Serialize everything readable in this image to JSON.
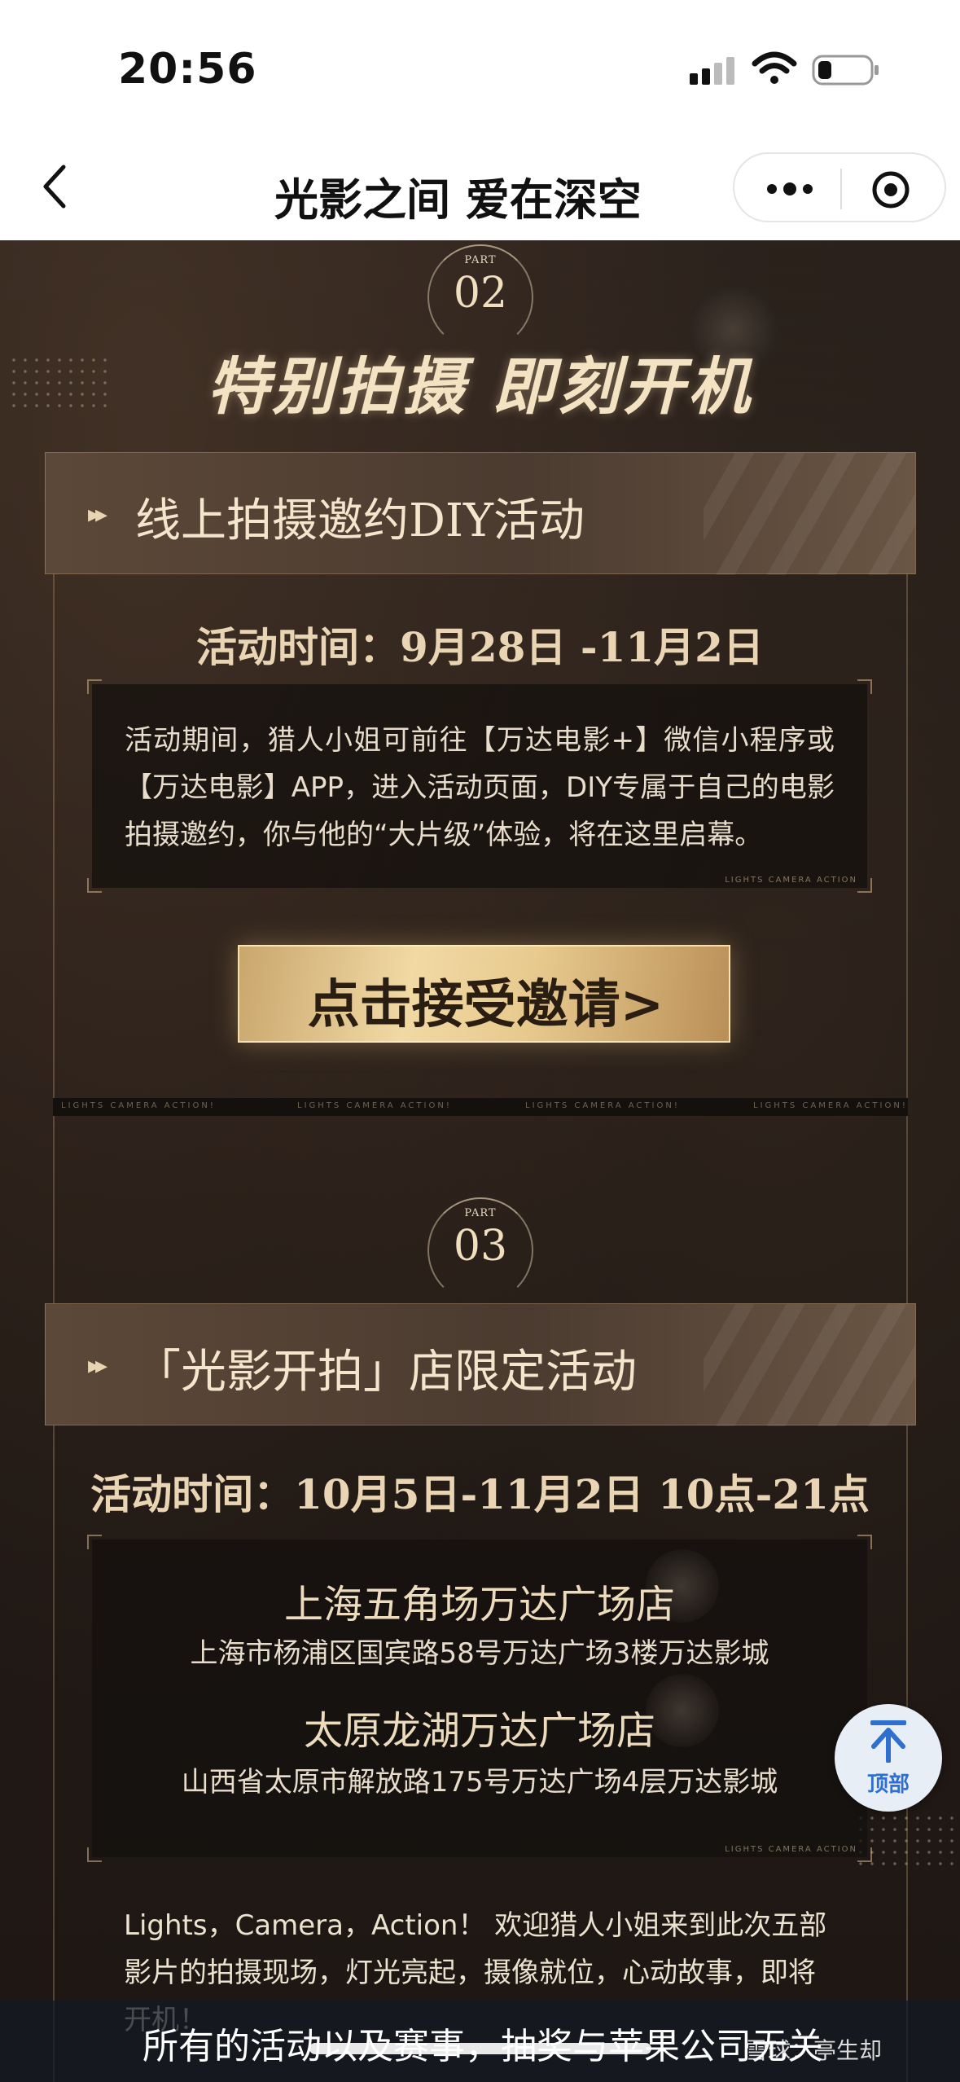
{
  "status_bar": {
    "time": "20:56"
  },
  "nav": {
    "title": "光影之间 爱在深空"
  },
  "section2": {
    "part_label": "PART",
    "part_number": "02",
    "heading": "特别拍摄 即刻开机",
    "banner_title": "线上拍摄邀约DIY活动",
    "time": "活动时间：9月28日 -11月2日",
    "description": "活动期间，猎人小姐可前往【万达电影+】微信小程序或【万达电影】APP，进入活动页面，DIY专属于自己的电影拍摄邀约，你与他的“大片级”体验，将在这里启幕。",
    "box_tag": "LIGHTS CAMERA ACTION",
    "cta": "点击接受邀请>",
    "strip_text": "LIGHTS CAMERA ACTION!"
  },
  "section3": {
    "part_label": "PART",
    "part_number": "03",
    "banner_title": "「光影开拍」店限定活动",
    "time": "活动时间：10月5日-11月2日 10点-21点",
    "stores": [
      {
        "name": "上海五角场万达广场店",
        "address": "上海市杨浦区国宾路58号万达广场3楼万达影城"
      },
      {
        "name": "太原龙湖万达广场店",
        "address": "山西省太原市解放路175号万达广场4层万达影城"
      }
    ],
    "box_tag": "LIGHTS CAMERA ACTION",
    "intro": "Lights，Camera，Action！ 欢迎猎人小姐来到此次五部影片的拍摄现场，灯光亮起，摄像就位，心动故事，即将开机！"
  },
  "top_button": {
    "label": "顶部"
  },
  "caption": {
    "text": "所有的活动以及赛事，抽奖与苹果公司无关",
    "watermark": "雪球：亭生却"
  }
}
